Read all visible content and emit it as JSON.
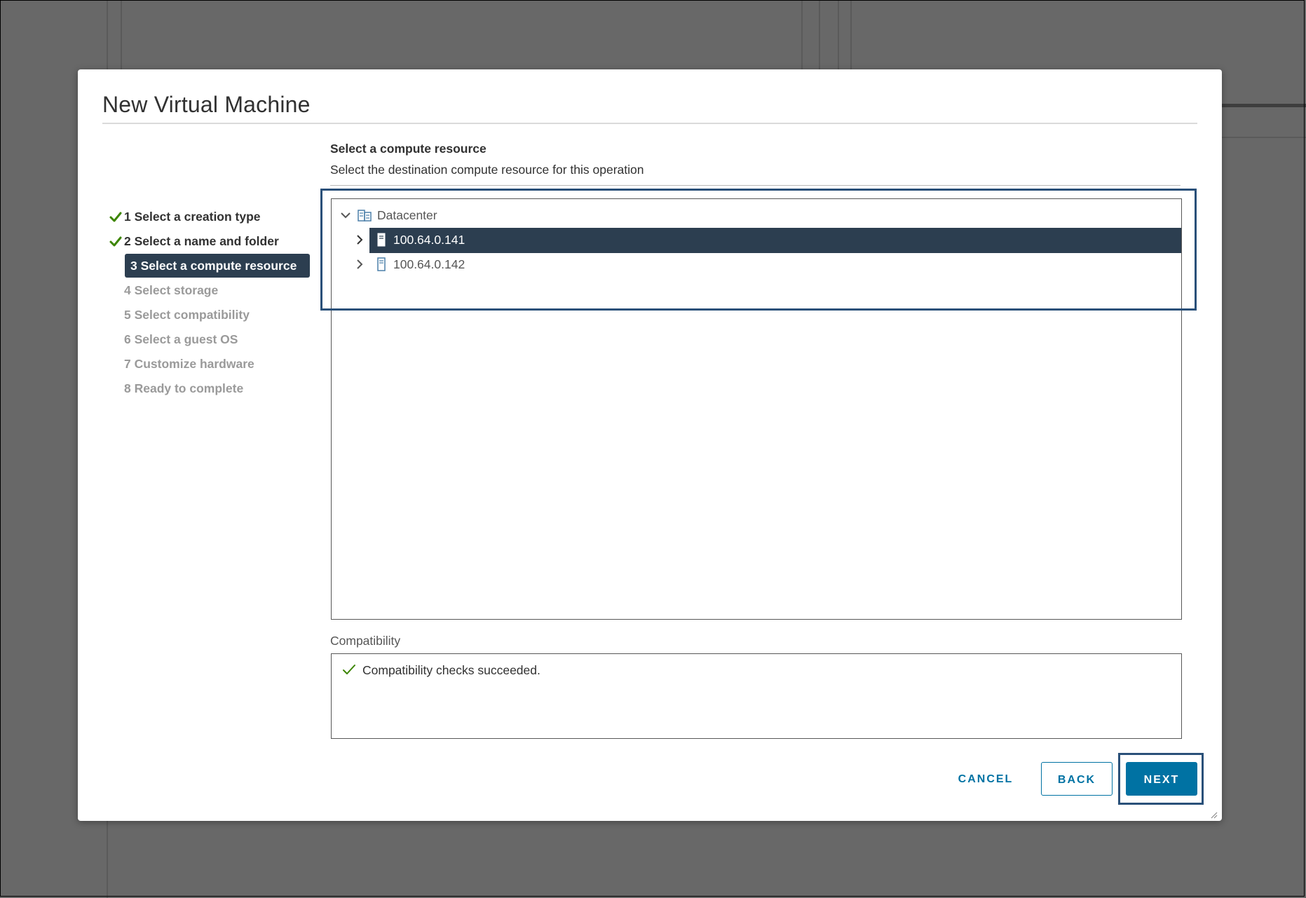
{
  "dialog": {
    "title": "New Virtual Machine"
  },
  "steps": [
    {
      "label": "1 Select a creation type",
      "state": "done"
    },
    {
      "label": "2 Select a name and folder",
      "state": "done"
    },
    {
      "label": "3 Select a compute resource",
      "state": "active"
    },
    {
      "label": "4 Select storage",
      "state": "todo"
    },
    {
      "label": "5 Select compatibility",
      "state": "todo"
    },
    {
      "label": "6 Select a guest OS",
      "state": "todo"
    },
    {
      "label": "7 Customize hardware",
      "state": "todo"
    },
    {
      "label": "8 Ready to complete",
      "state": "todo"
    }
  ],
  "content": {
    "heading": "Select a compute resource",
    "description": "Select the destination compute resource for this operation"
  },
  "tree": {
    "root": {
      "label": "Datacenter",
      "icon": "datacenter-icon",
      "expanded": true
    },
    "hosts": [
      {
        "label": "100.64.0.141",
        "icon": "host-icon",
        "selected": true,
        "expanded": false
      },
      {
        "label": "100.64.0.142",
        "icon": "host-icon",
        "selected": false,
        "expanded": false
      }
    ]
  },
  "compatibility": {
    "label": "Compatibility",
    "message": "Compatibility checks succeeded.",
    "status_icon": "check-icon"
  },
  "buttons": {
    "cancel": "CANCEL",
    "back": "BACK",
    "next": "NEXT"
  },
  "colors": {
    "accent": "#0072a3",
    "selected_bg": "#2c3e50",
    "success": "#3c8500",
    "highlight_frame": "#2a5079"
  }
}
